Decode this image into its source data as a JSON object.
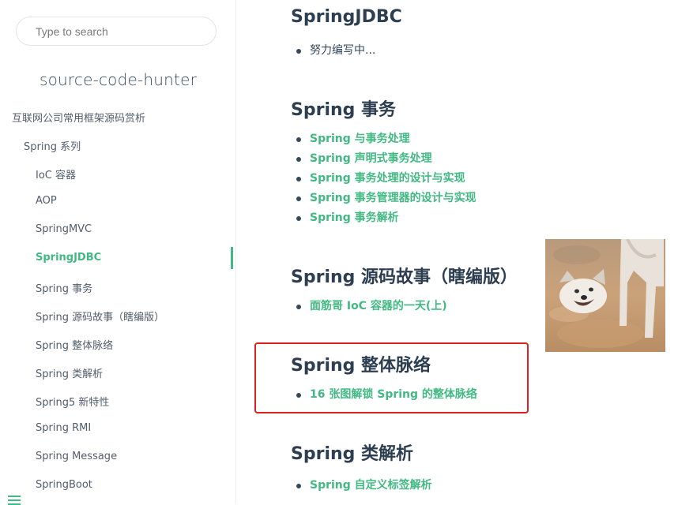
{
  "search": {
    "placeholder": "Type to search"
  },
  "app_name": "source-code-hunter",
  "sidebar": {
    "items": [
      {
        "label": "互联网公司常用框架源码赏析"
      },
      {
        "label": "Spring 系列"
      },
      {
        "label": "IoC 容器"
      },
      {
        "label": "AOP"
      },
      {
        "label": "SpringMVC"
      },
      {
        "label": "SpringJDBC"
      },
      {
        "label": "Spring 事务"
      },
      {
        "label": "Spring 源码故事（瞎编版）"
      },
      {
        "label": "Spring 整体脉络"
      },
      {
        "label": "Spring 类解析"
      },
      {
        "label": "Spring5 新特性"
      },
      {
        "label": "Spring RMI"
      },
      {
        "label": "Spring Message"
      },
      {
        "label": "SpringBoot"
      }
    ],
    "active_index": 5
  },
  "content": {
    "sections": [
      {
        "title": "SpringJDBC",
        "items": [
          "努力编写中..."
        ]
      },
      {
        "title": "Spring 事务",
        "items": [
          "Spring 与事务处理",
          "Spring 声明式事务处理",
          "Spring 事务处理的设计与实现",
          "Spring 事务管理器的设计与实现",
          "Spring 事务解析"
        ]
      },
      {
        "title": "Spring 源码故事（瞎编版）",
        "items": [
          "面筋哥 IoC 容器的一天(上)"
        ]
      },
      {
        "title": "Spring 整体脉络",
        "items": [
          "16 张图解锁 Spring 的整体脉络"
        ]
      },
      {
        "title": "Spring 类解析",
        "items": [
          "Spring 自定义标签解析"
        ]
      }
    ]
  },
  "colors": {
    "accent": "#42b983",
    "text": "#34495e",
    "heading": "#2c3e50",
    "highlight_border": "#e02020"
  },
  "icons": {
    "menu": "hamburger-menu-icon"
  }
}
